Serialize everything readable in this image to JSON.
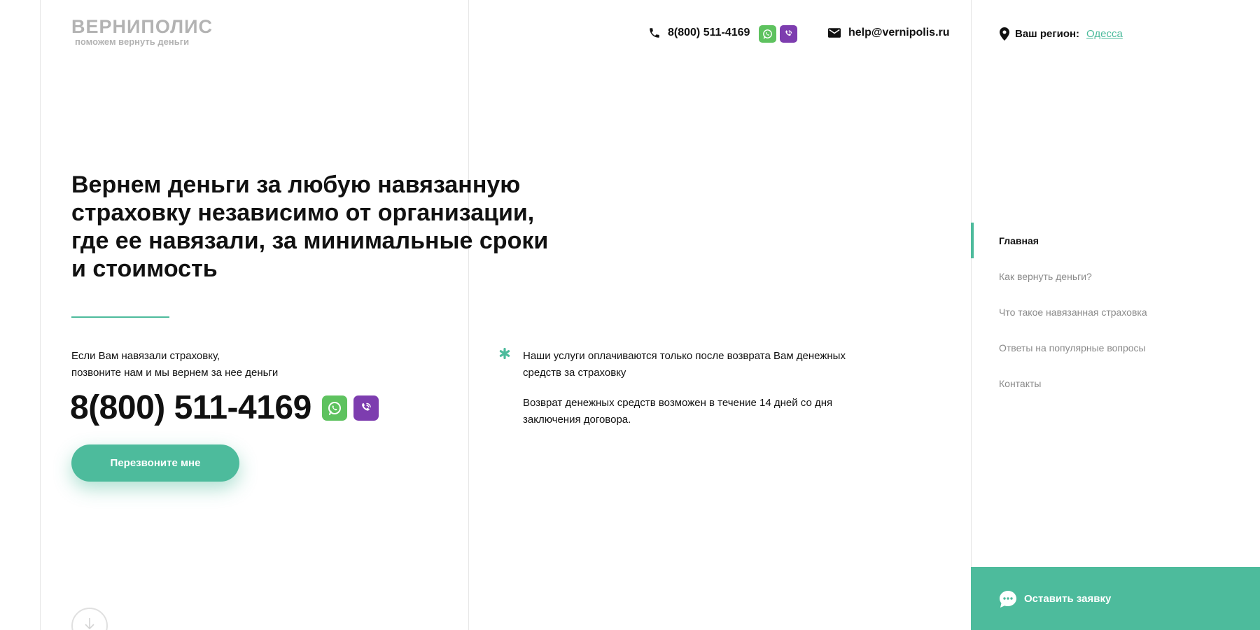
{
  "logo": {
    "title": "ВЕРНИПОЛИС",
    "subtitle": "поможем вернуть деньги"
  },
  "header": {
    "phone": "8(800) 511-4169",
    "email": "help@vernipolis.ru",
    "region_label": "Ваш регион:",
    "region_city": "Одесса"
  },
  "hero": {
    "title": "Вернем деньги за любую навязанную страховку независимо от организации, где ее навязали, за минимальные сроки и стоимость",
    "text_line1": "Если Вам навязали страховку,",
    "text_line2": "позвоните нам и мы вернем за нее деньги",
    "phone": "8(800) 511-4169",
    "cta_label": "Перезвоните мне"
  },
  "info": {
    "item1": "Наши услуги оплачиваются только после возврата Вам денежных средств за страховку",
    "item2": "Возврат денежных средств возможен в течение 14 дней со дня заключения договора."
  },
  "nav": {
    "items": [
      {
        "label": "Главная"
      },
      {
        "label": "Как вернуть деньги?"
      },
      {
        "label": "Что такое навязанная страховка"
      },
      {
        "label": "Ответы на популярные вопросы"
      },
      {
        "label": "Контакты"
      }
    ]
  },
  "request": {
    "label": "Оставить заявку"
  },
  "colors": {
    "accent": "#4dbb9c",
    "whatsapp": "#5ec25f",
    "viber": "#7d3daf",
    "logo": "#b3b3b3",
    "nav_inactive": "#8a8a8a"
  },
  "icons": {
    "phone": "phone-icon",
    "whatsapp": "whatsapp-icon",
    "viber": "viber-icon",
    "mail": "mail-icon",
    "location": "location-pin-icon",
    "asterisk": "asterisk-icon",
    "chat": "chat-bubble-icon",
    "scroll": "arrow-down-icon"
  }
}
